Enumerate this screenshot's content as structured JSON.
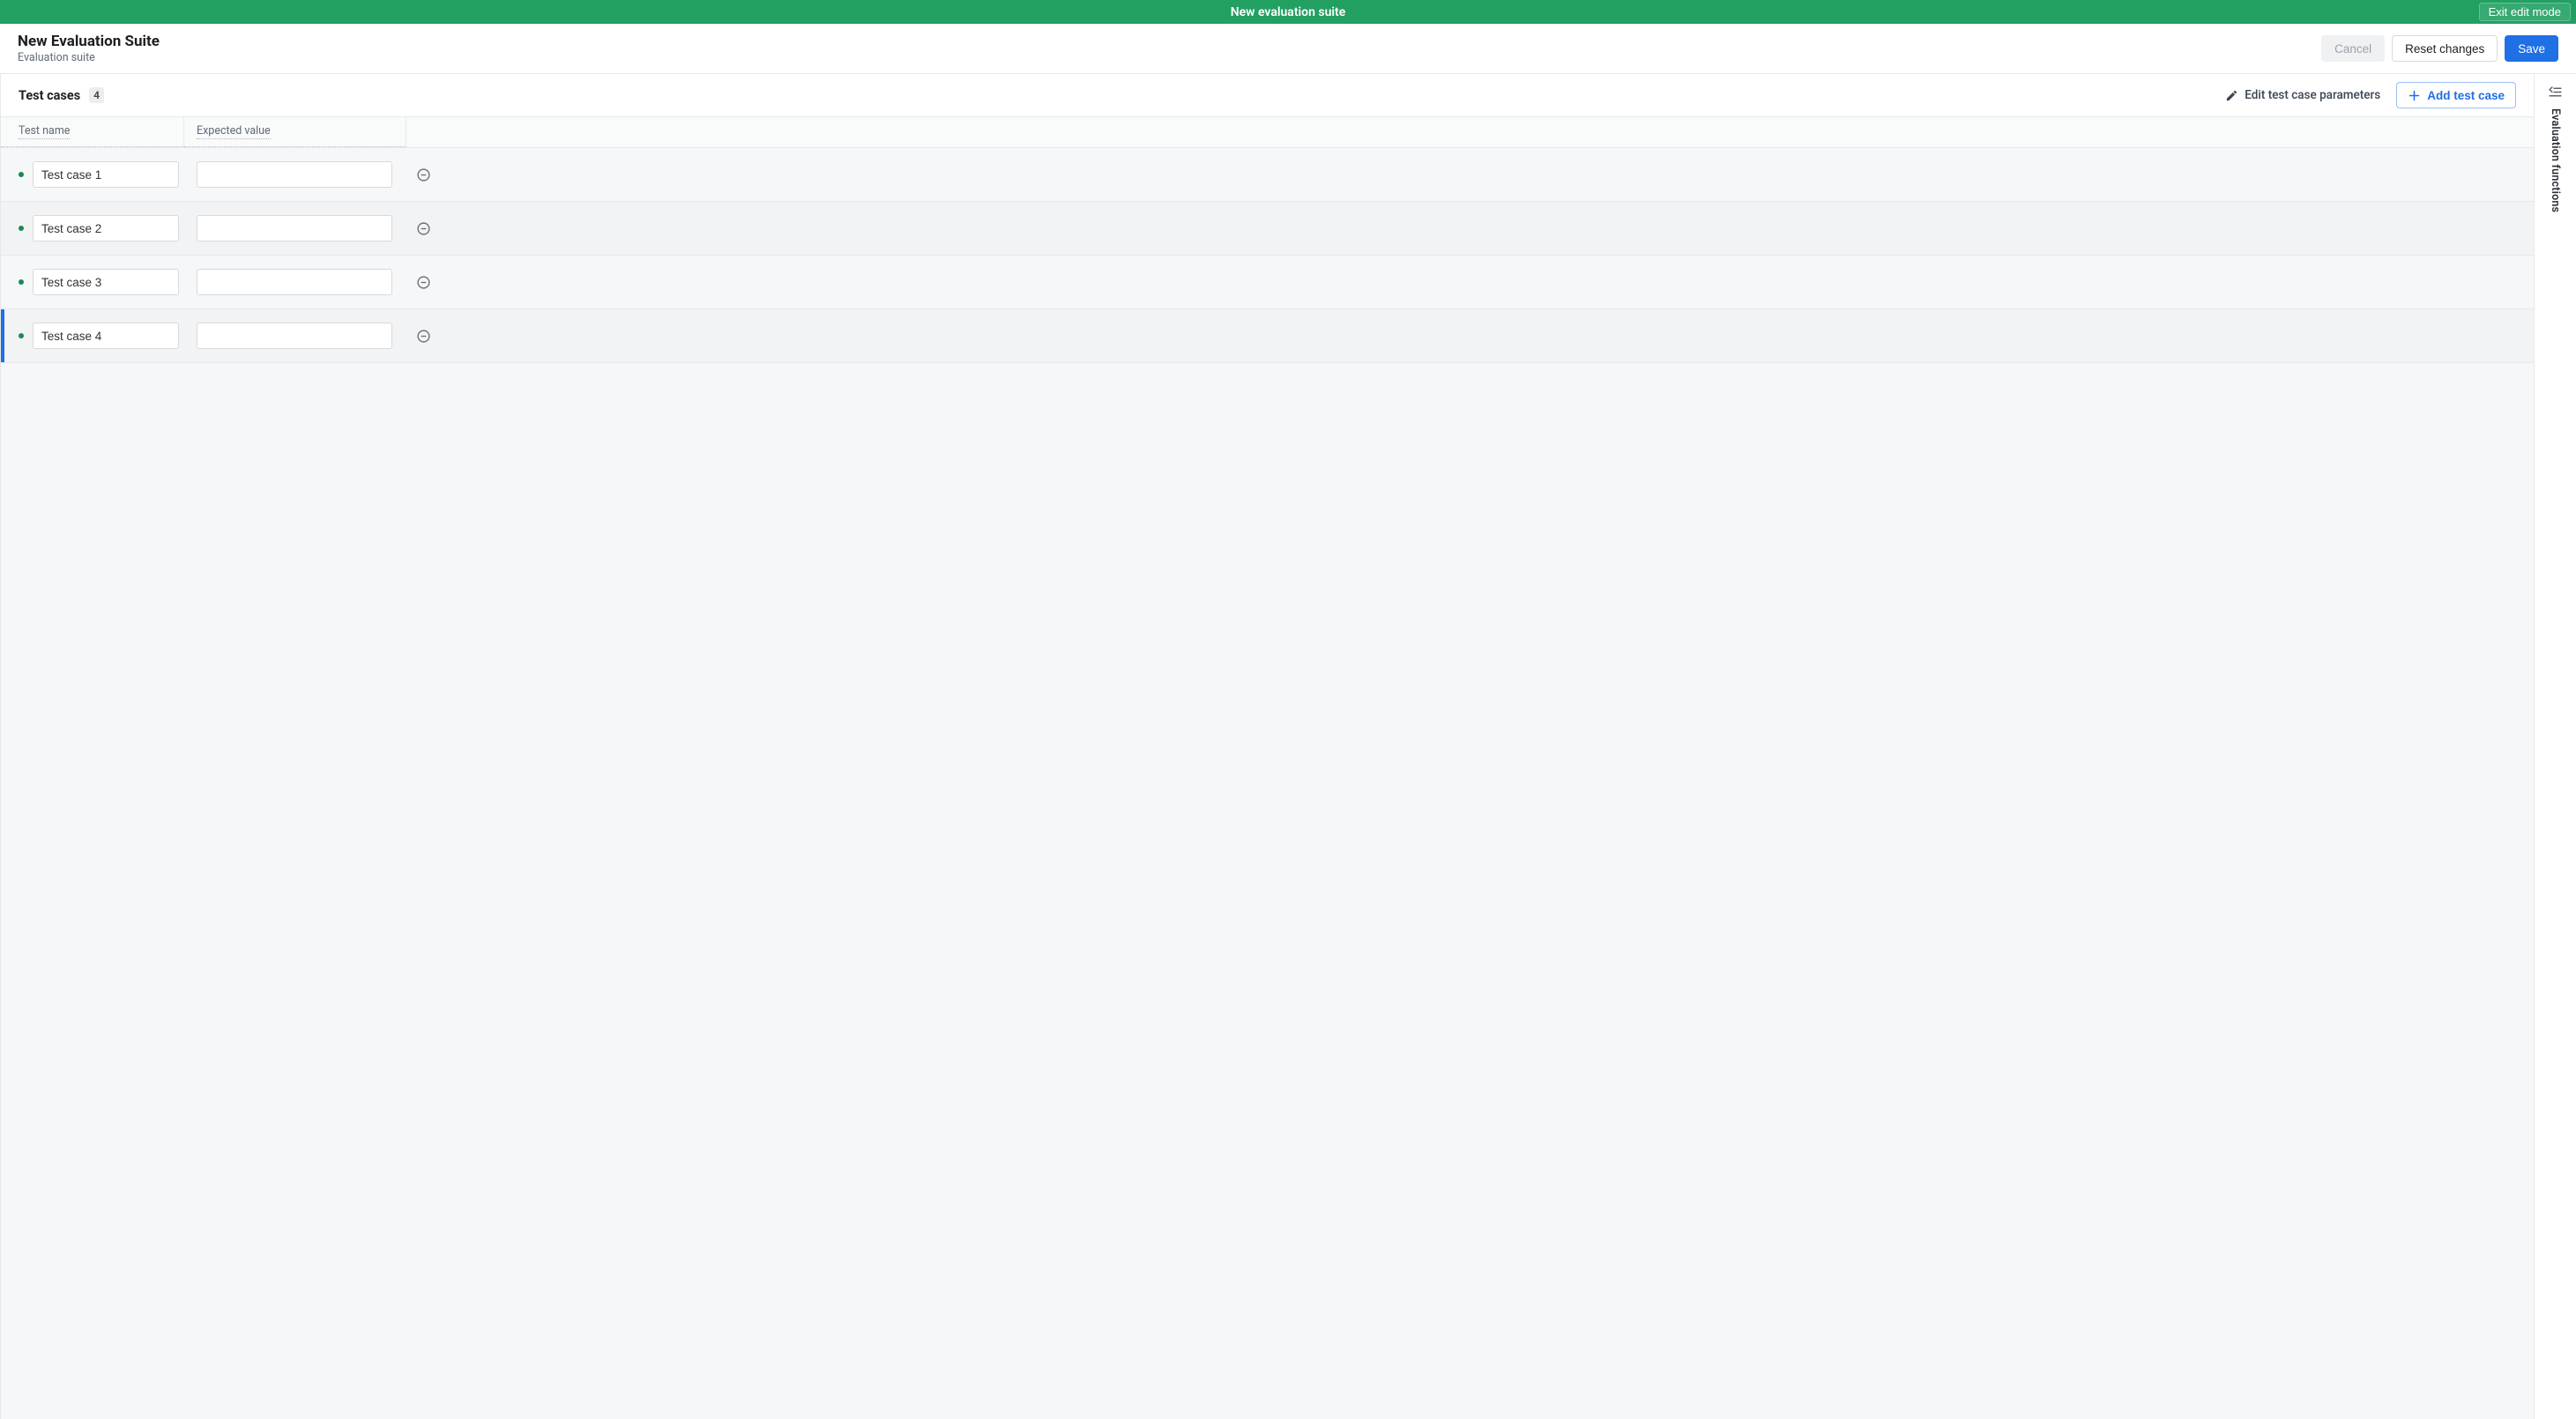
{
  "topbar": {
    "title": "New evaluation suite",
    "exit_label": "Exit edit mode"
  },
  "header": {
    "title": "New Evaluation Suite",
    "subtitle": "Evaluation suite",
    "cancel_label": "Cancel",
    "reset_label": "Reset changes",
    "save_label": "Save"
  },
  "toolbar": {
    "title": "Test cases",
    "count": "4",
    "edit_params_label": "Edit test case parameters",
    "add_label": "Add test case"
  },
  "columns": {
    "name": "Test name",
    "expected": "Expected value"
  },
  "rows": [
    {
      "name": "Test case 1",
      "expected": "",
      "active": false
    },
    {
      "name": "Test case 2",
      "expected": "",
      "active": false
    },
    {
      "name": "Test case 3",
      "expected": "",
      "active": false
    },
    {
      "name": "Test case 4",
      "expected": "",
      "active": true
    }
  ],
  "rail": {
    "label": "Evaluation functions"
  }
}
